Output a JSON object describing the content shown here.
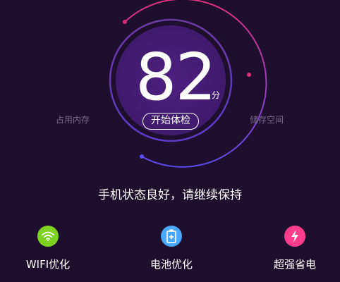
{
  "score": {
    "value": "82",
    "unit": "分",
    "start_label": "开始体检"
  },
  "sides": {
    "left_label": "占用内存",
    "right_label": "储存空间"
  },
  "status_text": "手机状态良好，请继续保持",
  "features": [
    {
      "label": "WIFI优化",
      "icon": "wifi-icon",
      "color": "#7ed321"
    },
    {
      "label": "电池优化",
      "icon": "battery-icon",
      "color": "#4aa8ff"
    },
    {
      "label": "超强省电",
      "icon": "lightning-icon",
      "color": "#ff3d8b"
    }
  ],
  "colors": {
    "background": "#1e0f2e",
    "inner_circle": "#4a1d7a",
    "ring_pink": "#e0307a",
    "ring_blue": "#5a4cf0",
    "side_label": "#7b6a8c"
  }
}
